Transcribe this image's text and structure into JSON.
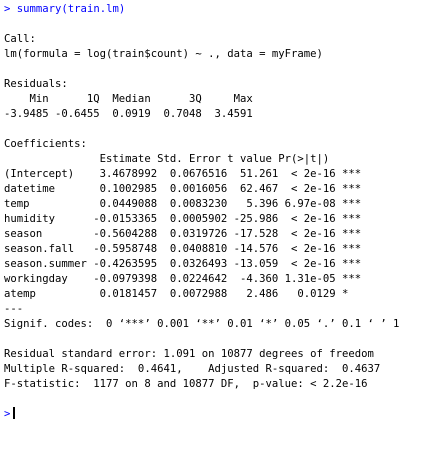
{
  "console": {
    "prompt_symbol": ">",
    "command": "summary(train.lm)",
    "call_header": "Call:",
    "call_formula": "lm(formula = log(train$count) ~ ., data = myFrame)",
    "residuals_header": "Residuals:",
    "residuals_labels": "    Min      1Q  Median      3Q     Max ",
    "residuals_values": "-3.9485 -0.6455  0.0919  0.7048  3.4591 ",
    "coefficients_header": "Coefficients:",
    "coef_columns": "               Estimate Std. Error t value Pr(>|t|)    ",
    "coef_rows": [
      "(Intercept)    3.4678992  0.0676516  51.261  < 2e-16 ***",
      "datetime       0.1002985  0.0016056  62.467  < 2e-16 ***",
      "temp           0.0449088  0.0083230   5.396 6.97e-08 ***",
      "humidity      -0.0153365  0.0005902 -25.986  < 2e-16 ***",
      "season        -0.5604288  0.0319726 -17.528  < 2e-16 ***",
      "season.fall   -0.5958748  0.0408810 -14.576  < 2e-16 ***",
      "season.summer -0.4263595  0.0326493 -13.059  < 2e-16 ***",
      "workingday    -0.0979398  0.0224642  -4.360 1.31e-05 ***",
      "atemp          0.0181457  0.0072988   2.486   0.0129 *  "
    ],
    "separator": "---",
    "signif_codes": "Signif. codes:  0 ‘***’ 0.001 ‘**’ 0.01 ‘*’ 0.05 ‘.’ 0.1 ‘ ’ 1",
    "rse_line": "Residual standard error: 1.091 on 10877 degrees of freedom",
    "r2_line": "Multiple R-squared:  0.4641,\tAdjusted R-squared:  0.4637 ",
    "f_line": "F-statistic:  1177 on 8 and 10877 DF,  p-value: < 2.2e-16"
  },
  "colors": {
    "command_text": "#0000ff",
    "output_text": "#000000",
    "background": "#ffffff"
  }
}
